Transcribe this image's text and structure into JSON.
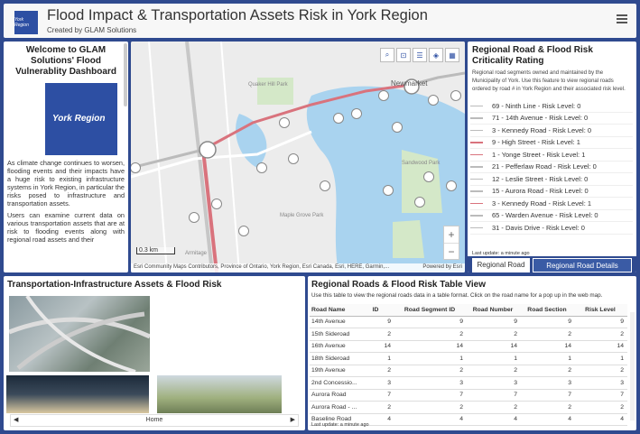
{
  "header": {
    "logo_text": "York Region",
    "title": "Flood Impact & Transportation Assets Risk in York Region",
    "subtitle": "Created by GLAM Solutions",
    "menu_icon": "hamburger-icon"
  },
  "intro": {
    "title": "Welcome to GLAM Solutions' Flood Vulnerablity Dashboard",
    "logo_text": "York Region",
    "p1": "As climate change continues to worsen, flooding events and their impacts have a huge risk to existing infrastructure systems in York Region, in particular the risks posed to infrastructure and transportation assets.",
    "p2": "Users can examine current data on various transportation assets that are at risk to flooding events along with regional road assets and their"
  },
  "map": {
    "labels": [
      "Newmarket",
      "Armitage",
      "Quaker Hill Park",
      "Fairy Lake",
      "Glenway Park",
      "Maple Grove Park",
      "Sandwood Park",
      "Forest Park"
    ],
    "scale": "0.3 km",
    "attribution": "Esri Community Maps Contributors, Province of Ontario, York Region, Esri Canada, Esri, HERE, Garmin,...",
    "powered": "Powered by Esri",
    "zoom_in": "+",
    "zoom_out": "−"
  },
  "criticality": {
    "title": "Regional Road & Flood Risk Criticality Rating",
    "description": "Regional road segments owned and maintained by the Municipality of York. Use this feature to view regional roads ordered by road # in York Region and their associated risk level.",
    "items": [
      {
        "label": "69  -  Ninth Line  -  Risk Level: 0",
        "color": "#bbbbbb"
      },
      {
        "label": "71  -  14th Avenue  -  Risk Level: 0",
        "color": "#bbbbbb"
      },
      {
        "label": "3  -  Kennedy Road  -  Risk Level: 0",
        "color": "#bbbbbb"
      },
      {
        "label": "9  -  High Street  -  Risk Level: 1",
        "color": "#d9737d"
      },
      {
        "label": "1  -  Yonge Street  -  Risk Level: 1",
        "color": "#d9737d"
      },
      {
        "label": "21  -  Pefferlaw Road  -  Risk Level: 0",
        "color": "#bbbbbb"
      },
      {
        "label": "12  -  Leslie Street  -  Risk Level: 0",
        "color": "#bbbbbb"
      },
      {
        "label": "15  -  Aurora Road  -  Risk Level: 0",
        "color": "#bbbbbb"
      },
      {
        "label": "3  -  Kennedy Road  -  Risk Level: 1",
        "color": "#d9737d"
      },
      {
        "label": "65  -  Warden Avenue  -  Risk Level: 0",
        "color": "#bbbbbb"
      },
      {
        "label": "31  -  Davis Drive  -  Risk Level: 0",
        "color": "#bbbbbb"
      }
    ],
    "updated": "Last update: a minute ago",
    "tab1": "Regional Road",
    "tab2": "Regional Road Details"
  },
  "assets": {
    "title": "Transportation-Infrastructure Assets & Flood Risk",
    "nav_label": "Home",
    "prev": "◀",
    "next": "▶"
  },
  "table": {
    "title": "Regional Roads & Flood Risk Table View",
    "description": "Use this table to view the regional roads data in a table format. Click on the road name for a pop up in the web map.",
    "columns": [
      "Road Name",
      "ID",
      "Road Segment ID",
      "Road Number",
      "Road Section",
      "Risk Level"
    ],
    "rows": [
      [
        "14th Avenue",
        "9",
        "9",
        "9",
        "9",
        "9"
      ],
      [
        "15th Sideroad",
        "2",
        "2",
        "2",
        "2",
        "2"
      ],
      [
        "16th Avenue",
        "14",
        "14",
        "14",
        "14",
        "14"
      ],
      [
        "18th Sideroad",
        "1",
        "1",
        "1",
        "1",
        "1"
      ],
      [
        "19th Avenue",
        "2",
        "2",
        "2",
        "2",
        "2"
      ],
      [
        "2nd Concessio...",
        "3",
        "3",
        "3",
        "3",
        "3"
      ],
      [
        "Aurora Road",
        "7",
        "7",
        "7",
        "7",
        "7"
      ],
      [
        "Aurora Road - ...",
        "2",
        "2",
        "2",
        "2",
        "2"
      ],
      [
        "Baseline Road",
        "4",
        "4",
        "4",
        "4",
        "4"
      ]
    ],
    "updated": "Last update: a minute ago"
  }
}
